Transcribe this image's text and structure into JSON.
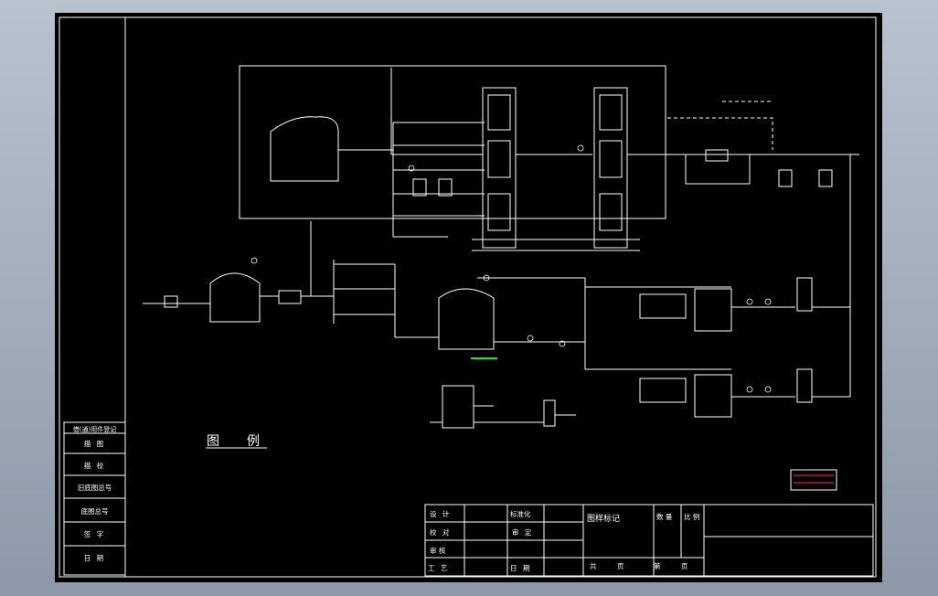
{
  "colors": {
    "background": "#000000",
    "line": "#ffffff",
    "highlight": "#27e02b",
    "accent": "#ff3030",
    "viewport": "#9aa5b5"
  },
  "side_column": {
    "header": "借(通)用件登记",
    "rows": [
      "描 图",
      "描 校",
      "旧底图总号",
      "底图总号",
      "签 字",
      "日 期"
    ]
  },
  "legend": {
    "title": "图例"
  },
  "title_block": {
    "design": "设 计",
    "check": "校 对",
    "review": "审 核",
    "process": "工 艺",
    "standardize": "标准化",
    "approve": "审 定",
    "date": "日 期",
    "drawing_mark": "图样标记",
    "quantity": "数 量",
    "scale": "比 例",
    "total_pages": "共 页",
    "page": "第 页"
  }
}
